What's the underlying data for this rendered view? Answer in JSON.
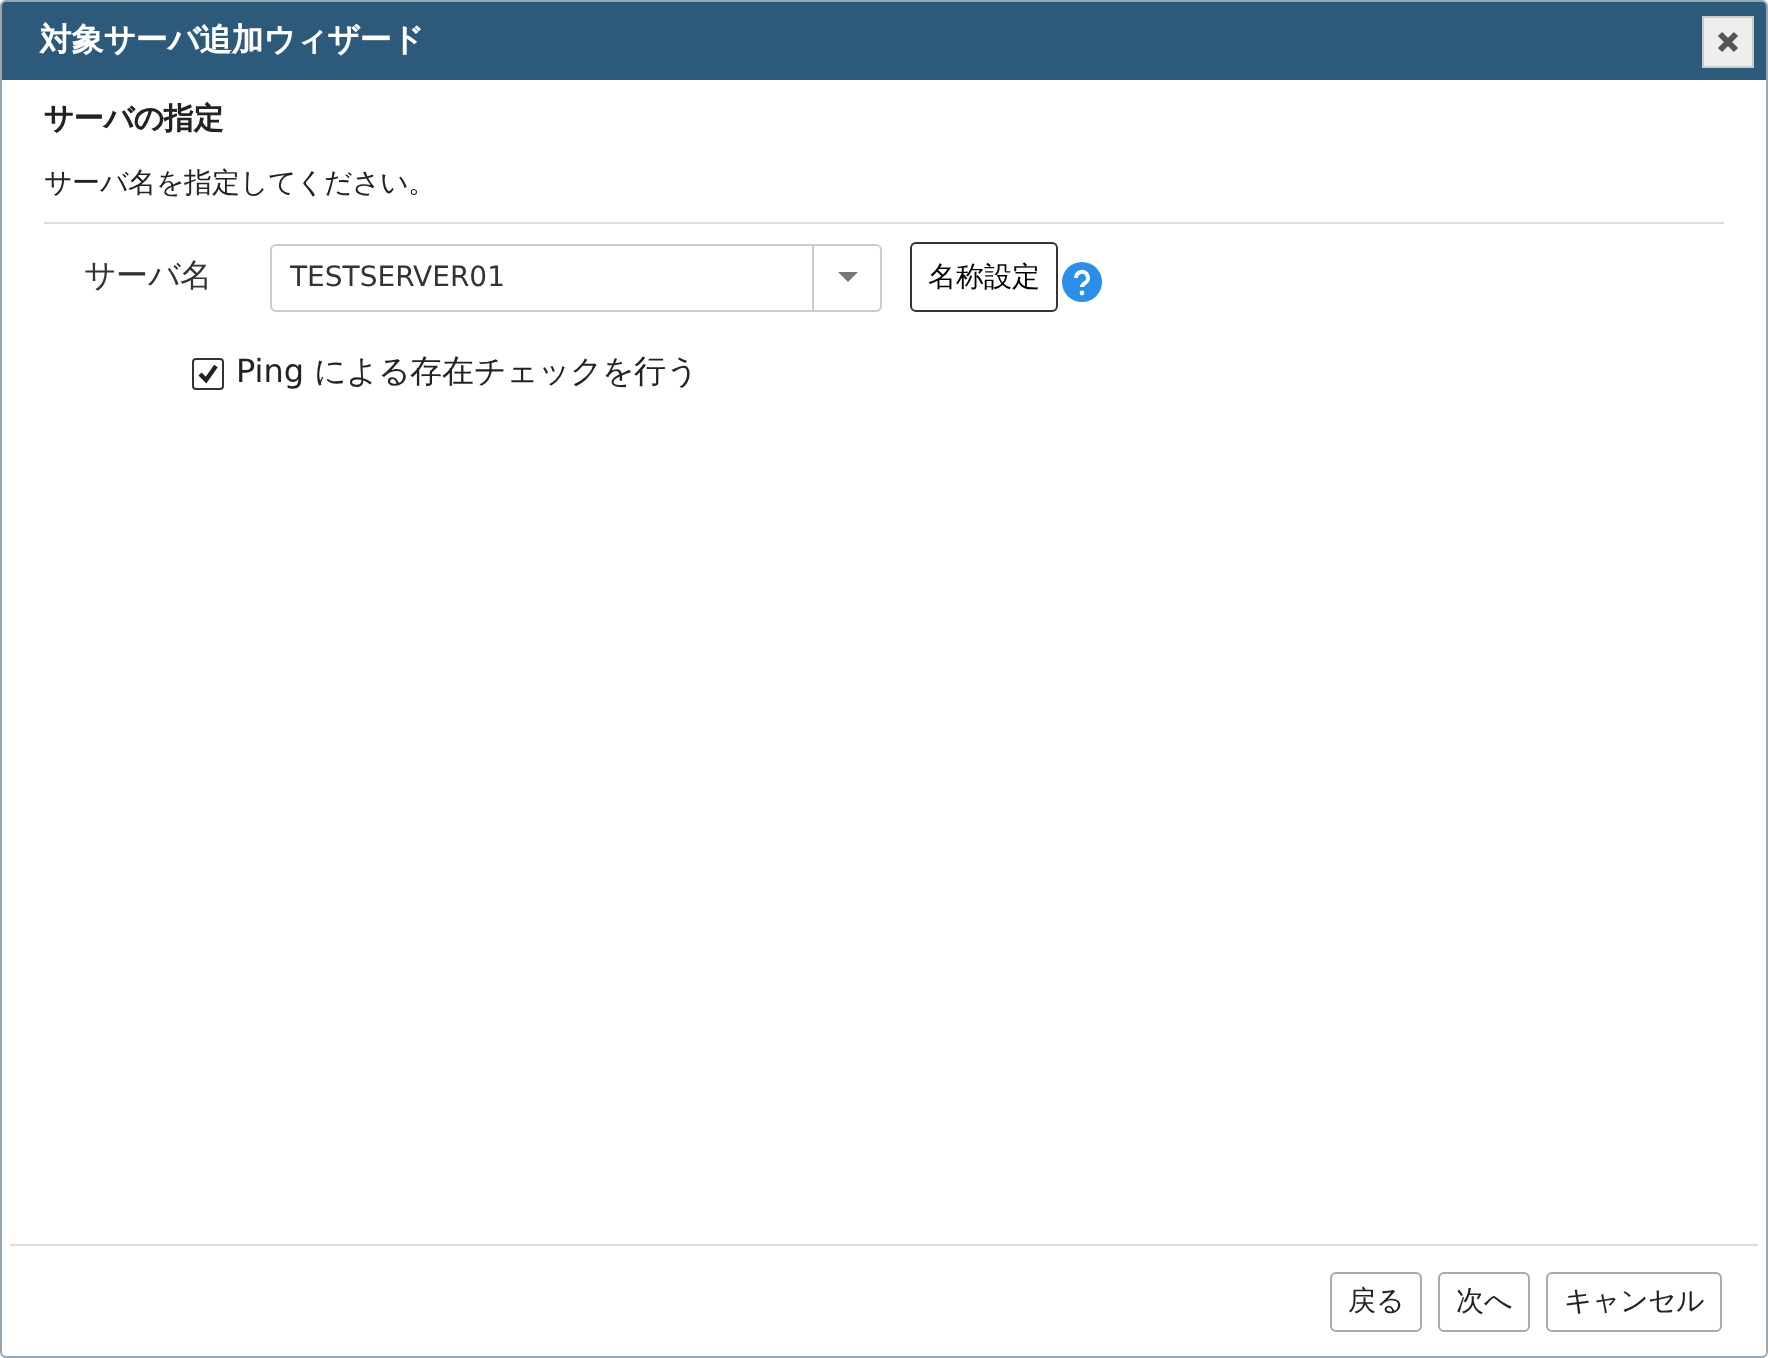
{
  "window": {
    "title": "対象サーバ追加ウィザード"
  },
  "section": {
    "heading": "サーバの指定",
    "description": "サーバ名を指定してください。"
  },
  "server_name": {
    "label": "サーバ名",
    "value": "TESTSERVER01",
    "naming_button": "名称設定"
  },
  "ping_check": {
    "label": "Ping による存在チェックを行う",
    "checked": true
  },
  "buttons": [
    "戻る",
    "次へ",
    "キャンセル"
  ]
}
